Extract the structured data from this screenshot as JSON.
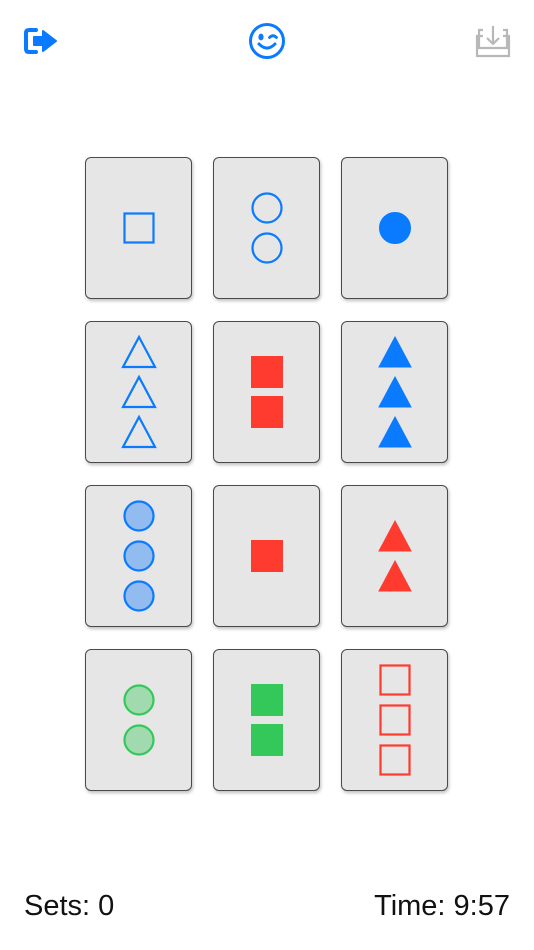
{
  "toolbar": {
    "exit_icon": "exit-icon",
    "emoji_icon": "winking-face-icon",
    "save_icon": "download-tray-icon"
  },
  "colors": {
    "blue": "#0a7aff",
    "red": "#ff3b30",
    "green": "#34c759",
    "disabled": "#b8b8b8"
  },
  "cards": [
    {
      "shape": "square",
      "color": "blue",
      "count": 1,
      "fill": "open"
    },
    {
      "shape": "circle",
      "color": "blue",
      "count": 2,
      "fill": "open"
    },
    {
      "shape": "circle",
      "color": "blue",
      "count": 1,
      "fill": "solid"
    },
    {
      "shape": "triangle",
      "color": "blue",
      "count": 3,
      "fill": "open"
    },
    {
      "shape": "square",
      "color": "red",
      "count": 2,
      "fill": "solid"
    },
    {
      "shape": "triangle",
      "color": "blue",
      "count": 3,
      "fill": "solid"
    },
    {
      "shape": "circle",
      "color": "blue",
      "count": 3,
      "fill": "striped"
    },
    {
      "shape": "square",
      "color": "red",
      "count": 1,
      "fill": "solid"
    },
    {
      "shape": "triangle",
      "color": "red",
      "count": 2,
      "fill": "solid"
    },
    {
      "shape": "circle",
      "color": "green",
      "count": 2,
      "fill": "striped"
    },
    {
      "shape": "square",
      "color": "green",
      "count": 2,
      "fill": "solid"
    },
    {
      "shape": "square",
      "color": "red",
      "count": 3,
      "fill": "open"
    }
  ],
  "status": {
    "sets": "Sets: 0",
    "time": "Time: 9:57"
  }
}
